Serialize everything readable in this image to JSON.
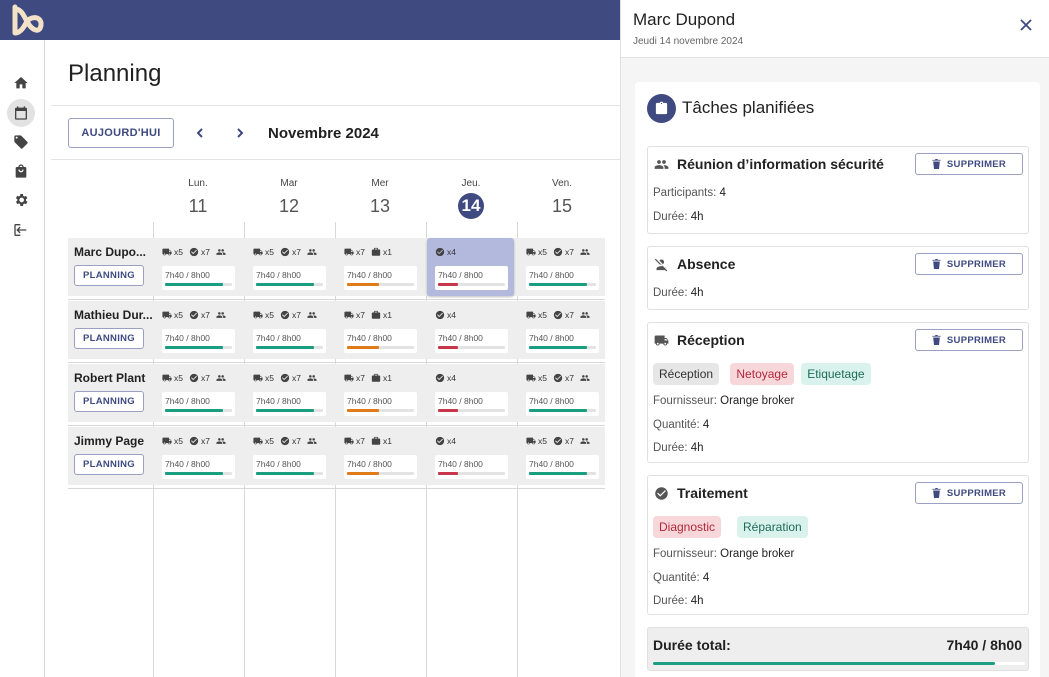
{
  "app": {
    "logo": "app-logo"
  },
  "nav": [
    {
      "icon": "home-icon",
      "active": false
    },
    {
      "icon": "calendar-icon",
      "active": true
    },
    {
      "icon": "tag-icon",
      "active": false
    },
    {
      "icon": "bag-icon",
      "active": false
    },
    {
      "icon": "gear-icon",
      "active": false
    },
    {
      "icon": "logout-icon",
      "active": false
    }
  ],
  "planning": {
    "title": "Planning",
    "today_label": "AUJOURD'HUI",
    "month": "Novembre 2024",
    "days": [
      {
        "name": "Lun.",
        "num": "11",
        "today": false
      },
      {
        "name": "Mar",
        "num": "12",
        "today": false
      },
      {
        "name": "Mer",
        "num": "13",
        "today": false
      },
      {
        "name": "Jeu.",
        "num": "14",
        "today": true
      },
      {
        "name": "Ven.",
        "num": "15",
        "today": false
      }
    ],
    "plan_label": "PLANNING",
    "people": [
      "Marc Dupo...",
      "Mathieu Dur...",
      "Robert Plant",
      "Jimmy Page"
    ],
    "day_cells": [
      {
        "counts": [
          {
            "icon": "truck-icon",
            "text": "x5"
          },
          {
            "icon": "check-icon",
            "text": "x7"
          },
          {
            "icon": "people-icon",
            "text": ""
          }
        ],
        "hours": "7h40 / 8h00",
        "progress": 0.86,
        "color": "#1a9e82"
      },
      {
        "counts": [
          {
            "icon": "truck-icon",
            "text": "x5"
          },
          {
            "icon": "check-icon",
            "text": "x7"
          },
          {
            "icon": "people-icon",
            "text": ""
          }
        ],
        "hours": "7h40 / 8h00",
        "progress": 0.86,
        "color": "#1a9e82"
      },
      {
        "counts": [
          {
            "icon": "truck-icon",
            "text": "x7"
          },
          {
            "icon": "box-icon",
            "text": "x1"
          }
        ],
        "hours": "7h40 / 8h00",
        "progress": 0.48,
        "color": "#e07b1a"
      },
      {
        "counts": [
          {
            "icon": "check-icon",
            "text": "x4"
          }
        ],
        "hours": "7h40 / 8h00",
        "progress": 0.3,
        "color": "#c9354a"
      },
      {
        "counts": [
          {
            "icon": "truck-icon",
            "text": "x5"
          },
          {
            "icon": "check-icon",
            "text": "x7"
          },
          {
            "icon": "people-icon",
            "text": ""
          }
        ],
        "hours": "7h40 / 8h00",
        "progress": 0.86,
        "color": "#1a9e82"
      }
    ],
    "highlight": {
      "row": 0,
      "col": 3
    }
  },
  "panel": {
    "name": "Marc Dupond",
    "date": "Jeudi 14 novembre 2024",
    "card_title": "Tâches planifiées",
    "delete_label": "SUPPRIMER",
    "tasks": [
      {
        "title": "Réunion d’information sécurité",
        "icon": "people-icon",
        "lines": [
          {
            "label": "Participants:",
            "value": "4"
          },
          {
            "label": "Durée:",
            "value": "4h"
          }
        ],
        "chips": []
      },
      {
        "title": "Absence",
        "icon": "person-off-icon",
        "lines": [
          {
            "label": "Durée:",
            "value": "4h"
          }
        ],
        "chips": []
      },
      {
        "title": "Réception",
        "icon": "truck-icon",
        "chips": [
          {
            "text": "Réception",
            "bg": "#e6e6e6",
            "fg": "#333333"
          },
          {
            "text": "Netoyage",
            "bg": "#f8d7da",
            "fg": "#b2283b"
          },
          {
            "text": "Etiquetage",
            "bg": "#d9f3ec",
            "fg": "#1e6b57"
          }
        ],
        "lines": [
          {
            "label": "Fournisseur:",
            "value": "Orange broker"
          },
          {
            "label": "Quantité:",
            "value": "4"
          },
          {
            "label": "Durée:",
            "value": "4h"
          }
        ]
      },
      {
        "title": "Traitement",
        "icon": "check-circle-icon",
        "chips": [
          {
            "text": "Diagnostic",
            "bg": "#f8d7da",
            "fg": "#b2283b"
          },
          {
            "text": "Réparation",
            "bg": "#d9f3ec",
            "fg": "#1e6b57"
          }
        ],
        "lines": [
          {
            "label": "Fournisseur:",
            "value": "Orange broker"
          },
          {
            "label": "Quantité:",
            "value": "4"
          },
          {
            "label": "Durée:",
            "value": "4h"
          }
        ]
      }
    ],
    "total_label": "Durée total:",
    "total_value": "7h40 / 8h00",
    "total_progress": 0.92
  },
  "colors": {
    "primary": "#3f4a80",
    "success": "#1a9e82",
    "warning": "#e07b1a",
    "danger": "#c9354a",
    "highlight": "#b3b9dd"
  }
}
